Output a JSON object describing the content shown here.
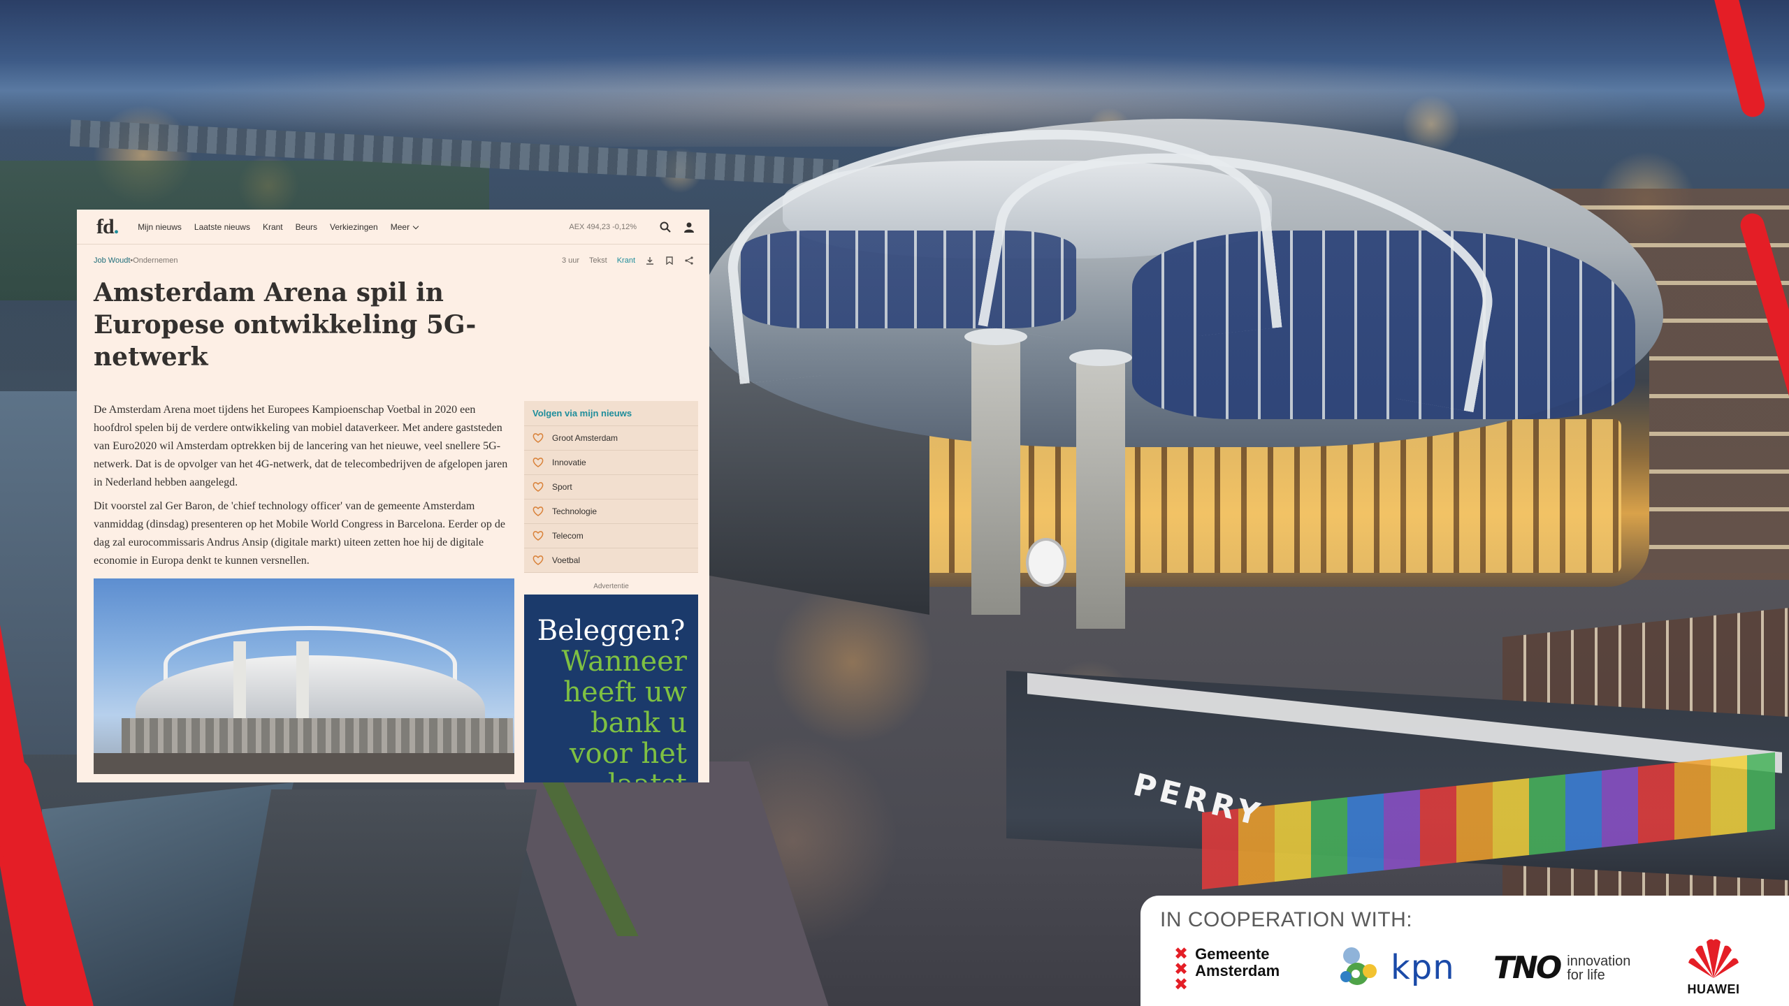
{
  "article_site": {
    "logo": "fd",
    "logo_dot": ".",
    "nav": [
      "Mijn nieuws",
      "Laatste nieuws",
      "Krant",
      "Beurs",
      "Verkiezingen",
      "Meer"
    ],
    "aex": "AEX 494,23 -0,12%",
    "icons": [
      "search-icon",
      "user-icon"
    ]
  },
  "article": {
    "author": "Job Woudt",
    "separator": " • ",
    "section": "Ondernemen",
    "time_ago": "3 uur",
    "tab_text": "Tekst",
    "tab_krant": "Krant",
    "headline": "Amsterdam Arena spil in Europese ontwikkeling 5G-netwerk",
    "paragraphs": [
      "De Amsterdam Arena moet tijdens het Europees Kampioenschap Voetbal in 2020 een hoofdrol spelen bij de verdere ontwikkeling van mobiel dataverkeer. Met andere gaststeden van Euro2020 wil Amsterdam optrekken bij de lancering van het nieuwe, veel snellere 5G-netwerk. Dat is de opvolger van het 4G-netwerk, dat de telecombedrijven de afgelopen jaren in Nederland hebben aangelegd.",
      "Dit voorstel zal Ger Baron, de 'chief technology officer' van de gemeente Amsterdam vanmiddag (dinsdag) presenteren op het Mobile World Congress in Barcelona. Eerder op de dag zal eurocommissaris Andrus Ansip (digitale markt) uiteen zetten hoe hij de digitale economie in Europa denkt te kunnen versnellen."
    ]
  },
  "follow": {
    "title": "Volgen via mijn nieuws",
    "topics": [
      "Groot Amsterdam",
      "Innovatie",
      "Sport",
      "Technologie",
      "Telecom",
      "Voetbal"
    ]
  },
  "ad": {
    "label": "Advertentie",
    "headline": "Beleggen?",
    "body": "Wanneer heeft uw bank u voor het laatst"
  },
  "background": {
    "sign_text": "PERRY"
  },
  "cooperation": {
    "title": "IN COOPERATION WITH:",
    "gemeente_line1": "Gemeente",
    "gemeente_line2": "Amsterdam",
    "kpn": "kpn",
    "tno": "TNO",
    "tno_tag_line1": "innovation",
    "tno_tag_line2": "for life",
    "huawei": "HUAWEI"
  },
  "colors": {
    "accent_red": "#e41e26",
    "fd_teal": "#1f8d9b",
    "fd_background": "#fdefe5",
    "ad_navy": "#1b3a6b",
    "ad_green": "#7fc142",
    "kpn_blue": "#1a4aa8"
  }
}
